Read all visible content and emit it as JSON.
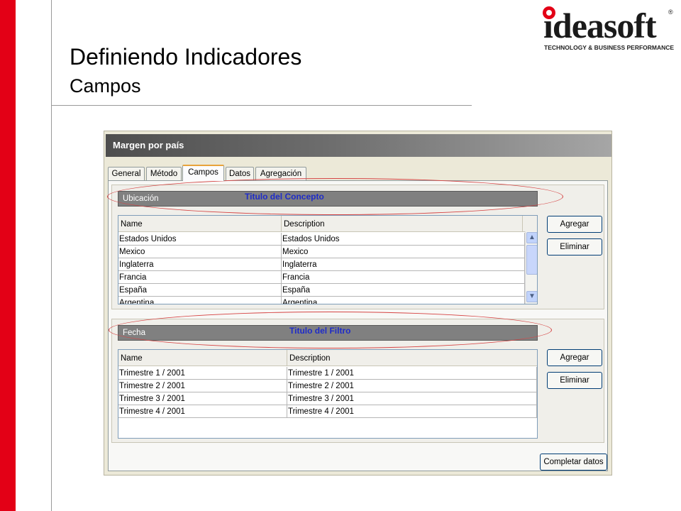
{
  "slide": {
    "title": "Definiendo Indicadores",
    "subtitle": "Campos"
  },
  "logo": {
    "word": "ideasoft",
    "registered": "®",
    "tagline": "TECHNOLOGY & BUSINESS PERFORMANCE"
  },
  "window": {
    "title": "Margen por país",
    "tabs": [
      {
        "label": "General",
        "active": false
      },
      {
        "label": "Método",
        "active": false
      },
      {
        "label": "Campos",
        "active": true
      },
      {
        "label": "Datos",
        "active": false
      },
      {
        "label": "Agregación",
        "active": false
      }
    ],
    "concept": {
      "bar_label": "Ubicación",
      "note": "Titulo del Concepto",
      "headers": [
        "Name",
        "Description"
      ],
      "rows": [
        [
          "Estados Unidos",
          "Estados Unidos"
        ],
        [
          "Mexico",
          "Mexico"
        ],
        [
          "Inglaterra",
          "Inglaterra"
        ],
        [
          "Francia",
          "Francia"
        ],
        [
          "España",
          "España"
        ],
        [
          "Argentina",
          "Argentina"
        ]
      ],
      "add_label": "Agregar",
      "remove_label": "Eliminar"
    },
    "filter": {
      "bar_label": "Fecha",
      "note": "Titulo del Filtro",
      "headers": [
        "Name",
        "Description"
      ],
      "rows": [
        [
          "Trimestre 1 / 2001",
          "Trimestre 1 / 2001"
        ],
        [
          "Trimestre 2 / 2001",
          "Trimestre 2 / 2001"
        ],
        [
          "Trimestre 3 / 2001",
          "Trimestre 3 / 2001"
        ],
        [
          "Trimestre 4 / 2001",
          "Trimestre 4 / 2001"
        ]
      ],
      "add_label": "Agregar",
      "remove_label": "Eliminar"
    },
    "complete_label": "Completar datos"
  },
  "colors": {
    "accent_red": "#e30016",
    "annotation_blue": "#1f2cc8",
    "ellipse_red": "#d64545"
  }
}
